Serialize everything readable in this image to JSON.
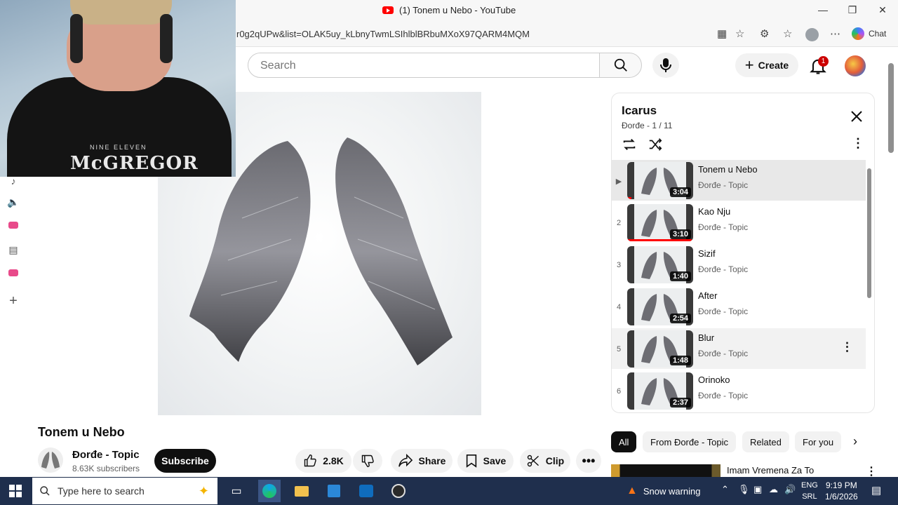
{
  "window": {
    "tab_title": "(1) Tonem u Nebo - YouTube",
    "url": "r0g2qUPw&list=OLAK5uy_kLbnyTwmLSIhlblBRbuMXoX97QARM4MQM",
    "chat_label": "Chat"
  },
  "header": {
    "search_placeholder": "Search",
    "create_label": "Create",
    "notification_count": "1"
  },
  "webcam": {
    "hoodie_text": "McGREGOR",
    "hoodie_small": "NINE ELEVEN"
  },
  "video": {
    "title": "Tonem u Nebo",
    "channel_name": "Đorđe - Topic",
    "subscribers": "8.63K subscribers",
    "subscribe_label": "Subscribe",
    "like_count": "2.8K",
    "share_label": "Share",
    "save_label": "Save",
    "clip_label": "Clip"
  },
  "playlist": {
    "title": "Icarus",
    "subtitle": "Đorđe - 1 / 11",
    "items": [
      {
        "index": "▶",
        "name": "Tonem u Nebo",
        "artist": "Đorđe - Topic",
        "duration": "3:04",
        "progress": 0.06
      },
      {
        "index": "2",
        "name": "Kao Nju",
        "artist": "Đorđe - Topic",
        "duration": "3:10",
        "progress": 0.98
      },
      {
        "index": "3",
        "name": "Sizif",
        "artist": "Đorđe - Topic",
        "duration": "1:40",
        "progress": 0
      },
      {
        "index": "4",
        "name": "After",
        "artist": "Đorđe - Topic",
        "duration": "2:54",
        "progress": 0
      },
      {
        "index": "5",
        "name": "Blur",
        "artist": "Đorđe - Topic",
        "duration": "1:48",
        "progress": 0
      },
      {
        "index": "6",
        "name": "Orinoko",
        "artist": "Đorđe - Topic",
        "duration": "2:37",
        "progress": 0
      }
    ]
  },
  "chips": [
    "All",
    "From Đorđe - Topic",
    "Related",
    "For you"
  ],
  "recommendation": {
    "title": "Imam Vremena Za To"
  },
  "taskbar": {
    "search_placeholder": "Type here to search",
    "weather": "Snow warning",
    "lang_top": "ENG",
    "lang_bottom": "SRL",
    "time": "9:19 PM",
    "date": "1/6/2026"
  },
  "colors": {
    "accent": "#ff0000",
    "taskbar": "#1f2f4d"
  }
}
